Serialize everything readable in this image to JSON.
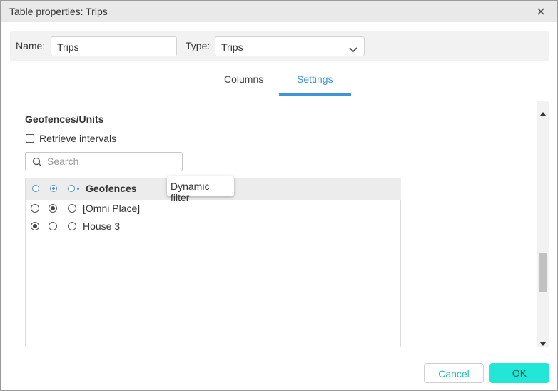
{
  "dialog": {
    "title": "Table properties: Trips"
  },
  "name_row": {
    "name_label": "Name:",
    "name_value": "Trips",
    "type_label": "Type:",
    "type_value": "Trips"
  },
  "tabs": [
    {
      "label": "Columns",
      "active": false
    },
    {
      "label": "Settings",
      "active": true
    }
  ],
  "settings": {
    "section_title": "Geofences/Units",
    "retrieve_intervals": {
      "label": "Retrieve intervals",
      "checked": false
    },
    "search": {
      "placeholder": "Search",
      "value": ""
    },
    "list_header": "Geofences",
    "rows": [
      {
        "label": "[Omni Place]",
        "selected": 1
      },
      {
        "label": "House 3",
        "selected": 0
      }
    ],
    "tooltip": "Dynamic filter"
  },
  "footer": {
    "cancel_label": "Cancel",
    "ok_label": "OK"
  },
  "colors": {
    "accent": "#3d94d9",
    "ok_button": "#22e6d6",
    "cancel_text": "#1cc3b8"
  },
  "icons": [
    "close-icon",
    "chevron-down-icon",
    "search-icon",
    "scroll-up-icon",
    "scroll-down-icon"
  ]
}
